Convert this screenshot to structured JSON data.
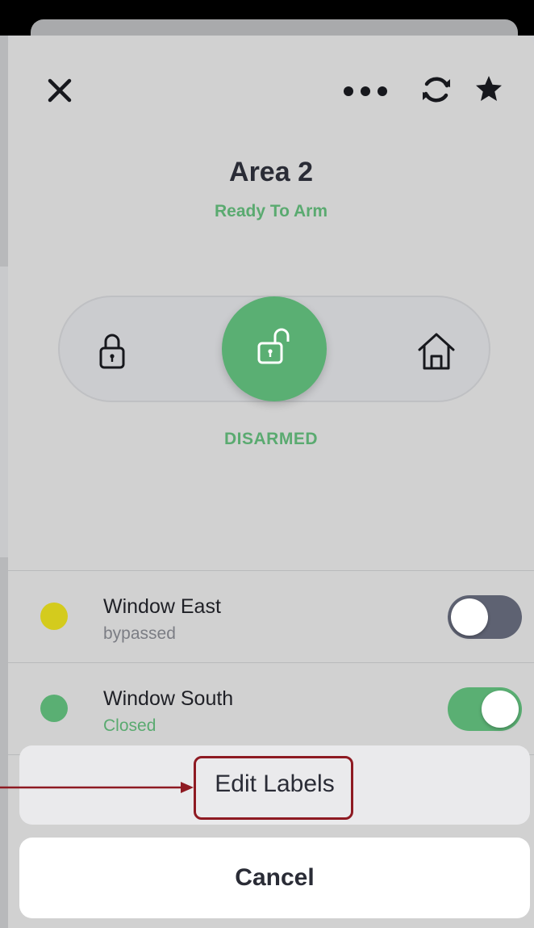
{
  "header": {
    "close_icon": "close-icon",
    "more_icon": "more-horizontal-icon",
    "refresh_icon": "refresh-icon",
    "favorite_icon": "star-icon"
  },
  "area": {
    "title": "Area 2",
    "status": "Ready To Arm",
    "mode": "DISARMED",
    "accent_color": "#5aaf73"
  },
  "arm_modes": [
    {
      "icon": "lock-icon",
      "selected": false
    },
    {
      "icon": "unlock-icon",
      "selected": true
    },
    {
      "icon": "home-icon",
      "selected": false
    }
  ],
  "zones": [
    {
      "name": "Window East",
      "state": "bypassed",
      "dot_color": "#d4cb1d",
      "state_color": "#7b7d84",
      "toggle_on": false,
      "toggle_color": "#5e6272"
    },
    {
      "name": "Window South",
      "state": "Closed",
      "dot_color": "#5aaf73",
      "state_color": "#5aaa70",
      "toggle_on": true,
      "toggle_color": "#5aaf73"
    }
  ],
  "action_sheet": {
    "edit_labels": "Edit Labels",
    "cancel": "Cancel",
    "highlight_color": "#8e1a22"
  }
}
